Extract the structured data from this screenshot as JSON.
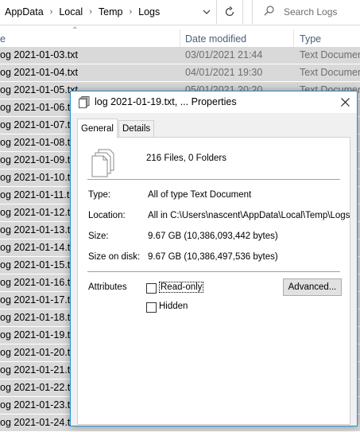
{
  "address_bar": {
    "breadcrumbs": [
      "AppData",
      "Local",
      "Temp",
      "Logs"
    ],
    "search_placeholder": "Search Logs"
  },
  "columns": {
    "name": "e",
    "date": "Date modified",
    "type": "Type"
  },
  "files": [
    {
      "name": "og 2021-01-03.txt",
      "date": "03/01/2021 21:44",
      "type": "Text Documen"
    },
    {
      "name": "og 2021-01-04.txt",
      "date": "04/01/2021 19:30",
      "type": "Text Documen"
    },
    {
      "name": "og 2021-01-05.txt",
      "date": "05/01/2021 20:20",
      "type": "Text Documen"
    },
    {
      "name": "og 2021-01-06.txt"
    },
    {
      "name": "og 2021-01-07.txt"
    },
    {
      "name": "og 2021-01-08.txt"
    },
    {
      "name": "og 2021-01-09.txt"
    },
    {
      "name": "og 2021-01-10.txt"
    },
    {
      "name": "og 2021-01-11.txt"
    },
    {
      "name": "og 2021-01-12.txt"
    },
    {
      "name": "og 2021-01-13.txt"
    },
    {
      "name": "og 2021-01-14.txt"
    },
    {
      "name": "og 2021-01-15.txt"
    },
    {
      "name": "og 2021-01-16.txt"
    },
    {
      "name": "og 2021-01-17.txt"
    },
    {
      "name": "og 2021-01-18.txt"
    },
    {
      "name": "og 2021-01-19.txt"
    },
    {
      "name": "og 2021-01-20.txt"
    },
    {
      "name": "og 2021-01-21.txt"
    },
    {
      "name": "og 2021-01-22.txt"
    },
    {
      "name": "og 2021-01-23.txt"
    },
    {
      "name": "og 2021-01-24.txt"
    }
  ],
  "dialog": {
    "title": "log 2021-01-19.txt, ... Properties",
    "tabs": [
      "General",
      "Details"
    ],
    "summary": "216 Files, 0 Folders",
    "type_label": "Type:",
    "type_value": "All of type Text Document",
    "location_label": "Location:",
    "location_value": "All in C:\\Users\\nascent\\AppData\\Local\\Temp\\Logs",
    "size_label": "Size:",
    "size_value": "9.67 GB (10,386,093,442 bytes)",
    "size_on_disk_label": "Size on disk:",
    "size_on_disk_value": "9.67 GB (10,386,497,536 bytes)",
    "attributes_label": "Attributes",
    "readonly_label": "Read-only",
    "hidden_label": "Hidden",
    "advanced_label": "Advanced..."
  }
}
